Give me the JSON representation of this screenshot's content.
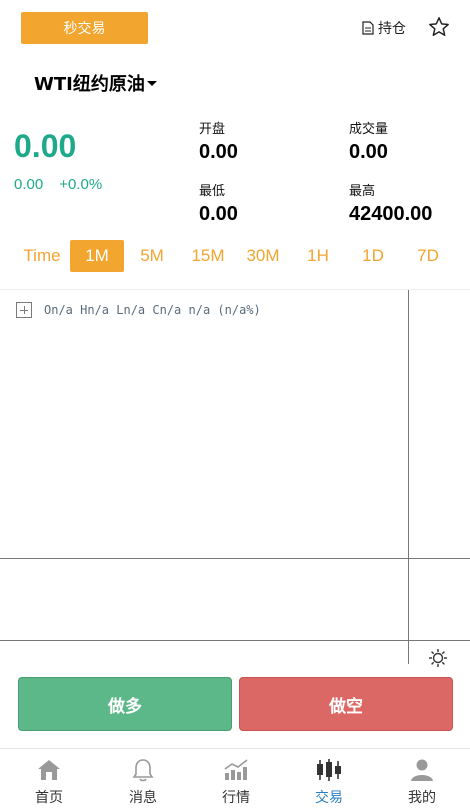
{
  "header": {
    "flash_trade_label": "秒交易",
    "holdings_label": "持仓"
  },
  "symbol": {
    "name": "WTI纽约原油"
  },
  "quote": {
    "price": "0.00",
    "change": "0.00",
    "change_pct": "+0.0%",
    "open_label": "开盘",
    "open_value": "0.00",
    "volume_label": "成交量",
    "volume_value": "0.00",
    "low_label": "最低",
    "low_value": "0.00",
    "high_label": "最高",
    "high_value": "42400.00"
  },
  "timeframes": {
    "items": [
      "Time",
      "1M",
      "5M",
      "15M",
      "30M",
      "1H",
      "1D",
      "7D"
    ],
    "active": "1M"
  },
  "chart": {
    "legend_text": "On/a Hn/a Ln/a Cn/a n/a (n/a%)"
  },
  "actions": {
    "long_label": "做多",
    "short_label": "做空"
  },
  "tabs": [
    {
      "label": "首页",
      "icon": "home-icon"
    },
    {
      "label": "消息",
      "icon": "bell-icon"
    },
    {
      "label": "行情",
      "icon": "market-chart-icon"
    },
    {
      "label": "交易",
      "icon": "candlestick-icon"
    },
    {
      "label": "我的",
      "icon": "user-icon"
    }
  ],
  "colors": {
    "accent": "#f2a52f",
    "up": "#1ea98b",
    "long": "#5cb888",
    "short": "#dc6866",
    "tab_active": "#2a7fc4"
  }
}
